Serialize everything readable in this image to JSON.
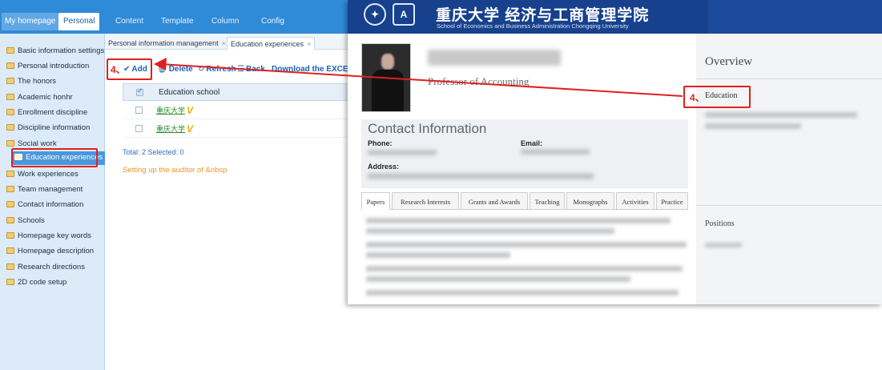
{
  "topnav": {
    "tabs": [
      {
        "label": "My homepage"
      },
      {
        "label": "Personal"
      },
      {
        "label": "Content"
      },
      {
        "label": "Template"
      },
      {
        "label": "Column"
      },
      {
        "label": "Config"
      }
    ],
    "active_index": 1
  },
  "sidebar": {
    "items": [
      {
        "label": "Basic information settings"
      },
      {
        "label": "Personal introduction"
      },
      {
        "label": "The honors"
      },
      {
        "label": "Academic honhr"
      },
      {
        "label": "Enrollment discipline"
      },
      {
        "label": "Discipline information"
      },
      {
        "label": "Social work"
      },
      {
        "label": "Education experiences"
      },
      {
        "label": "Work experiences"
      },
      {
        "label": "Team management"
      },
      {
        "label": "Contact information"
      },
      {
        "label": "Schools"
      },
      {
        "label": "Homepage key words"
      },
      {
        "label": "Homepage description"
      },
      {
        "label": "Research directions"
      },
      {
        "label": "2D code setup"
      }
    ],
    "active_index": 7
  },
  "content": {
    "tabs": [
      {
        "label": "Personal information management",
        "close": "×"
      },
      {
        "label": "Education experiences",
        "close": "×"
      }
    ],
    "toolbar": {
      "add_label": "Add",
      "delete_label": "Delete",
      "refresh_label": "Refresh",
      "back_label": "Back",
      "download_label": "Download the EXCEL"
    },
    "grid": {
      "header": "Education school",
      "rows": [
        {
          "school": "重庆大学",
          "mark": "V"
        },
        {
          "school": "重庆大学",
          "mark": "V"
        }
      ]
    },
    "total_text": "Total: 2 Selected: 0",
    "auditor_text": "Setting up the auditor of &nbsp"
  },
  "annotations": {
    "step_left": "4、",
    "step_right": "4、",
    "color": "#e02020"
  },
  "overlay": {
    "banner": {
      "cn_title": "重庆大学 经济与工商管理学院",
      "en_title": "School of Economics and Business Administration Chongqing University"
    },
    "profile": {
      "position_title": "Professor of Accounting",
      "contact_title": "Contact Information",
      "phone_label": "Phone:",
      "email_label": "Email:",
      "address_label": "Address:",
      "tabs": [
        {
          "label": "Papers"
        },
        {
          "label": "Research Interests"
        },
        {
          "label": "Grants and Awards"
        },
        {
          "label": "Teaching"
        },
        {
          "label": "Monographs"
        },
        {
          "label": "Activities"
        },
        {
          "label": "Practice"
        }
      ]
    },
    "side": {
      "overview": "Overview",
      "education": "Education",
      "positions": "Positions"
    }
  },
  "colors": {
    "nav_blue": "#2f8ad8",
    "sidebar_bg": "#dcebf7",
    "active_item": "#4a97dc",
    "banner_blue": "#17418d",
    "link_blue": "#1a64b8",
    "school_green": "#2a8a2a",
    "auditor_orange": "#e8962a"
  }
}
